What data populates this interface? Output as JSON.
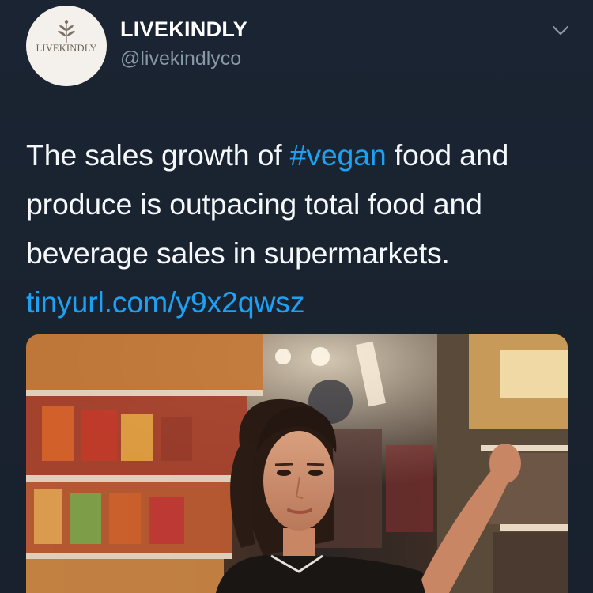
{
  "author": {
    "display_name": "LIVEKINDLY",
    "handle": "@livekindlyco",
    "avatar_logo_text": "LIVEKINDLY"
  },
  "tweet": {
    "text_before_hashtag": "The sales growth of ",
    "hashtag": "#vegan",
    "text_after_hashtag": " food and produce is outpacing total food and beverage sales in supermarkets.",
    "link": "tinyurl.com/y9x2qwsz"
  },
  "media": {
    "description_icon": "photo-woman-supermarket-aisle"
  },
  "icons": {
    "menu": "chevron-down-icon"
  },
  "colors": {
    "background": "#1b2432",
    "link": "#1da1f2",
    "secondary_text": "#8899a6",
    "primary_text": "#f5f8fa"
  }
}
